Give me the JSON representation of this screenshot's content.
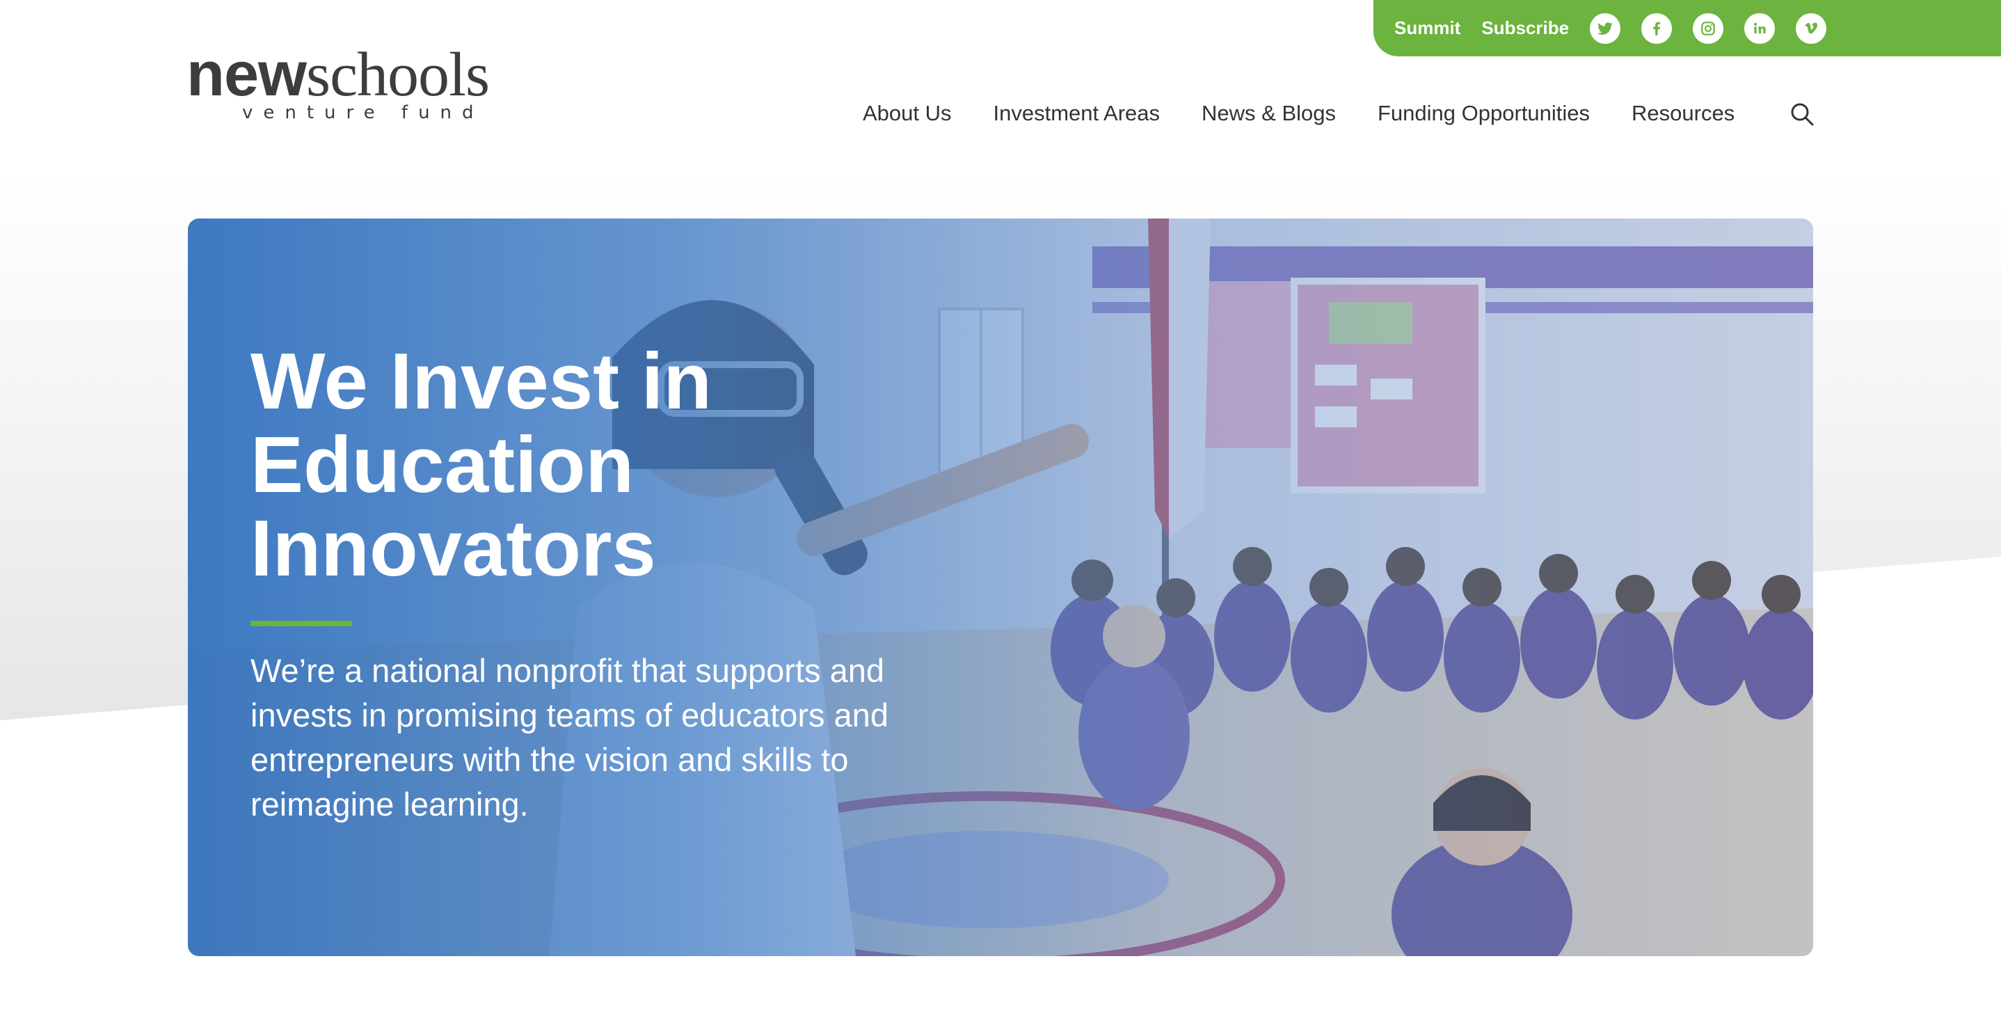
{
  "utility_bar": {
    "links": [
      "Summit",
      "Subscribe"
    ],
    "social_icons": [
      "twitter-icon",
      "facebook-icon",
      "instagram-icon",
      "linkedin-icon",
      "vimeo-icon"
    ],
    "color": "#6cb33f"
  },
  "logo": {
    "bold_part": "new",
    "light_part": "schools",
    "subtitle": "venture fund"
  },
  "nav": {
    "items": [
      "About Us",
      "Investment Areas",
      "News & Blogs",
      "Funding Opportunities",
      "Resources"
    ],
    "search_icon": "search-icon"
  },
  "hero": {
    "title": "We Invest in\nEducation\nInnovators",
    "text": "We’re a national nonprofit that supports and invests in promising teams of educators and entrepreneurs with the vision and skills to reimagine learning.",
    "accent_color": "#6cb33f",
    "overlay_color": "#3070be"
  }
}
